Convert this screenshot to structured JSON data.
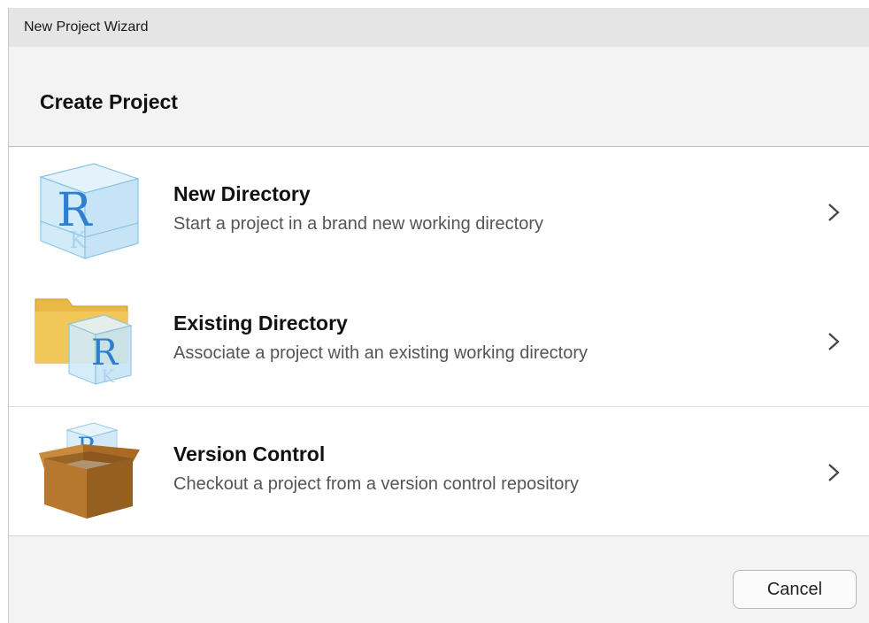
{
  "window": {
    "title": "New Project Wizard"
  },
  "header": {
    "title": "Create Project"
  },
  "options": [
    {
      "title": "New Directory",
      "description": "Start a project in a brand new working directory",
      "icon": "r-cube-icon"
    },
    {
      "title": "Existing Directory",
      "description": "Associate a project with an existing working directory",
      "icon": "folder-r-icon"
    },
    {
      "title": "Version Control",
      "description": "Checkout a project from a version control repository",
      "icon": "box-r-icon"
    }
  ],
  "footer": {
    "cancel_label": "Cancel"
  },
  "colors": {
    "r_blue": "#2f7fd0",
    "cube_fill": "#d6ecf8",
    "folder": "#e7b53e",
    "box": "#b7772f"
  }
}
